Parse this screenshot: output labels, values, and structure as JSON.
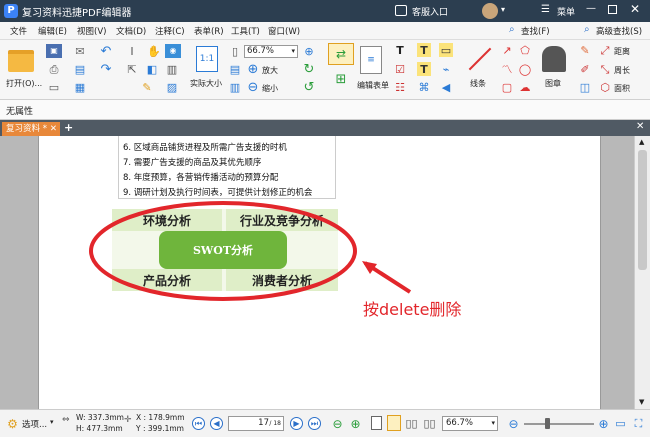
{
  "window": {
    "title": "复习资料迅捷PDF编辑器",
    "service_label": "客服入口",
    "menu_label": "菜单"
  },
  "menu": {
    "items": [
      "文件",
      "编辑(E)",
      "视图(V)",
      "文档(D)",
      "注释(C)",
      "表单(R)",
      "工具(T)",
      "窗口(W)"
    ],
    "search_label": "查找(F)",
    "advanced_search_label": "高级查找(S)"
  },
  "toolbar": {
    "open_label": "打开(O)...",
    "zoom_value": "66.7%",
    "actual_size_label": "实际大小",
    "zoom_in_label": "放大",
    "zoom_out_label": "缩小",
    "edit_form_label": "编辑表单",
    "lines_label": "线条",
    "stamp_label": "图章",
    "distance_label": "距离",
    "perimeter_label": "周长",
    "area_label": "面积"
  },
  "properties": {
    "label": "无属性"
  },
  "tabs": [
    {
      "label": "复习资料 *"
    }
  ],
  "document": {
    "lines": [
      "6. 区域商品铺货进程及所需广告支援的时机",
      "7. 需要广告支援的商品及其优先顺序",
      "8. 年度预算，各营销传播活动的预算分配",
      "9. 调研计划及执行时间表，可提供计划修正的机会"
    ],
    "swot": {
      "center": "SWOT分析",
      "top_left": "环境分析",
      "top_right": "行业及竞争分析",
      "bottom_left": "产品分析",
      "bottom_right": "消费者分析"
    },
    "annotation": "按delete删除"
  },
  "status": {
    "select_label": "选项...",
    "width": "W: 337.3mm",
    "height": "H: 477.3mm",
    "x": "X : 178.9mm",
    "y": "Y : 399.1mm",
    "page_current": "17",
    "page_total": "/ 18",
    "zoom": "66.7%"
  }
}
